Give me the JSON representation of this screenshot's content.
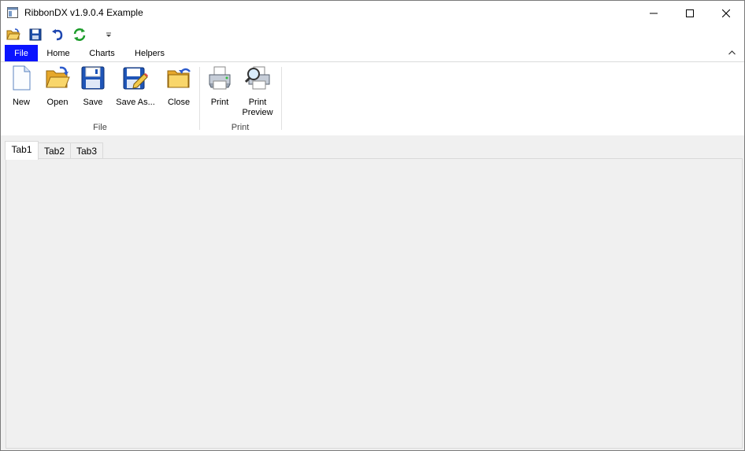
{
  "window": {
    "title": "RibbonDX v1.9.0.4 Example"
  },
  "qat": {
    "icons": [
      "open-folder-icon",
      "save-disk-icon",
      "undo-icon",
      "refresh-icon",
      "customize-dropdown-icon"
    ]
  },
  "ribbon_tabs": [
    {
      "label": "File",
      "selected": true
    },
    {
      "label": "Home"
    },
    {
      "label": "Charts"
    },
    {
      "label": "Helpers"
    }
  ],
  "ribbon": {
    "groups": [
      {
        "label": "File",
        "buttons": [
          {
            "label": "New",
            "icon": "new-document-icon"
          },
          {
            "label": "Open",
            "icon": "open-folder-icon"
          },
          {
            "label": "Save",
            "icon": "save-disk-icon"
          },
          {
            "label": "Save As...",
            "icon": "save-as-icon"
          },
          {
            "label": "Close",
            "icon": "close-folder-icon"
          }
        ]
      },
      {
        "label": "Print",
        "buttons": [
          {
            "label": "Print",
            "icon": "printer-icon"
          },
          {
            "label": "Print Preview",
            "label_lines": [
              "Print",
              "Preview"
            ],
            "icon": "print-preview-icon"
          }
        ]
      }
    ]
  },
  "document_tabs": [
    {
      "label": "Tab1",
      "selected": true
    },
    {
      "label": "Tab2"
    },
    {
      "label": "Tab3"
    }
  ],
  "colors": {
    "file_tab": "#0a14ff",
    "content_bg": "#f0f0f0"
  }
}
